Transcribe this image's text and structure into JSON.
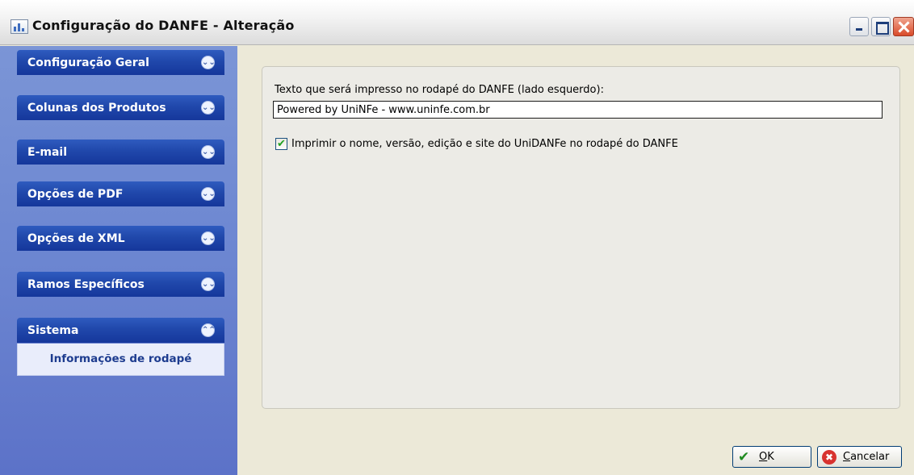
{
  "window": {
    "title": "Configuração do DANFE - Alteração"
  },
  "sidebar": {
    "groups": [
      {
        "label": "Configuração Geral",
        "expanded": false
      },
      {
        "label": "Colunas dos Produtos",
        "expanded": false
      },
      {
        "label": "E-mail",
        "expanded": false
      },
      {
        "label": "Opções de PDF",
        "expanded": false
      },
      {
        "label": "Opções de XML",
        "expanded": false
      },
      {
        "label": "Ramos Específicos",
        "expanded": false
      },
      {
        "label": "Sistema",
        "expanded": true
      }
    ],
    "sistema_items": [
      {
        "label": "Informações de rodapé"
      }
    ]
  },
  "main": {
    "footer_label": "Texto que será impresso no rodapé do DANFE (lado esquerdo):",
    "footer_value": "Powered by UniNFe - www.uninfe.com.br",
    "print_checkbox": {
      "label": "Imprimir o nome, versão, edição e site do UniDANFe no rodapé do DANFE",
      "checked": true
    }
  },
  "buttons": {
    "ok_mnemonic": "O",
    "ok_rest": "K",
    "cancel_mnemonic": "C",
    "cancel_rest": "ancelar"
  },
  "colors": {
    "sidebar_header": "#2048ab",
    "sidebar_bg": "#6c86d1",
    "selected_item_text": "#1d3c8f",
    "check_mark": "#21a121"
  },
  "icons": {
    "collapsed": "chevron-double-down-icon",
    "expanded": "chevron-double-up-icon"
  }
}
